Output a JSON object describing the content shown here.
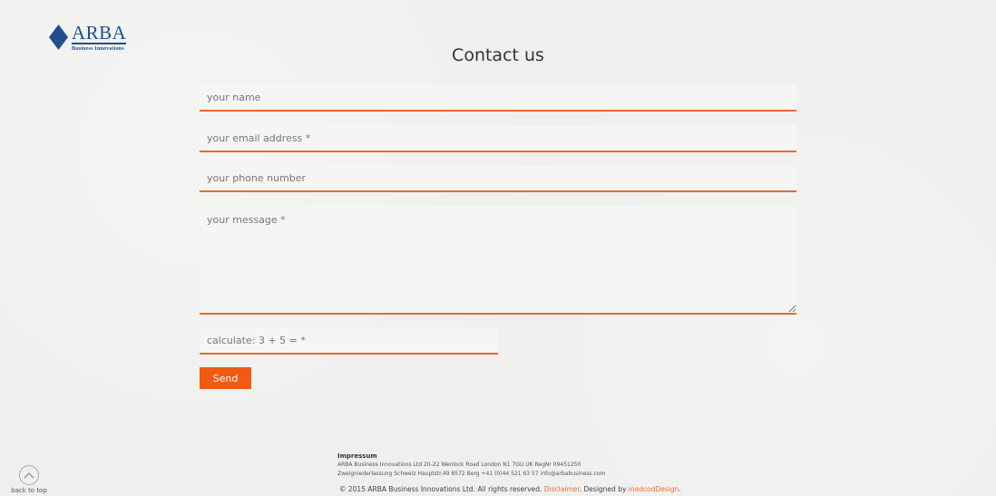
{
  "brand": {
    "name": "ARBA",
    "tagline": "Business Innovations",
    "logo_icon": "diamond-icon",
    "color": "#1f4f8f"
  },
  "page": {
    "title": "Contact us"
  },
  "form": {
    "name_placeholder": "your name",
    "email_placeholder": "your email address *",
    "phone_placeholder": "your phone number",
    "message_placeholder": "your message *",
    "captcha_placeholder": "calculate: 3 + 5 = *",
    "send_label": "Send",
    "accent_color": "#e86a2a",
    "button_color": "#f05a12"
  },
  "footer": {
    "impressum_title": "Impressum",
    "impressum_line1": "ARBA Business Innovations Ltd 20-22 Wenlock Road London N1 7GU UK RegNr 09451250",
    "impressum_line2": "Zweigniederlassung Schweiz Hauptstr.49 8572 Berg +41 (0)44 521 63 57 info@arbabusiness.com",
    "copyright_text": "© 2015 ARBA Business Innovations Ltd. All rights reserved.",
    "disclaimer_label": "Disclaimer",
    "designed_by_text": ". Designed by",
    "designer_label": "inadcodDesign",
    "end_text": "."
  },
  "back_to_top": {
    "label": "back to top",
    "icon": "chevron-up-circle-icon"
  }
}
